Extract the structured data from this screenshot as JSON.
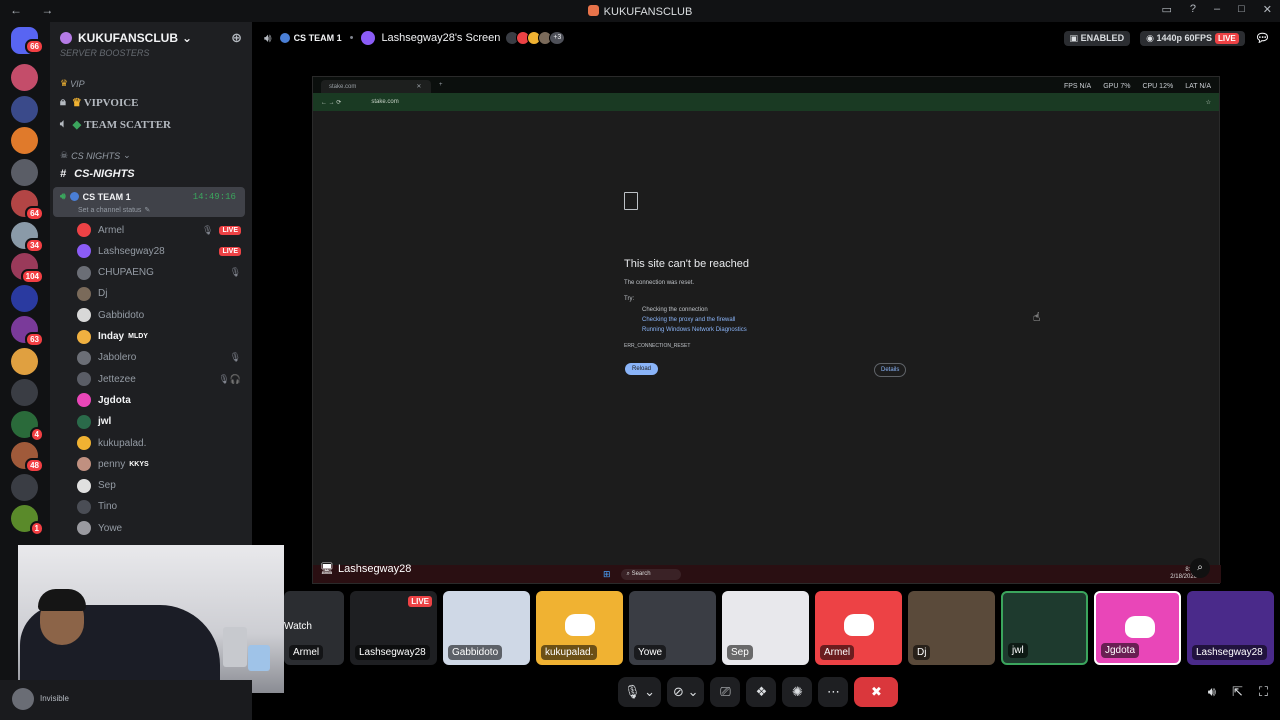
{
  "window": {
    "title": "KUKUFANSCLUB",
    "nav_label": "← →",
    "controls": [
      "▭",
      "?",
      "–",
      "□",
      "✕"
    ]
  },
  "rail": {
    "dm_badge": "66",
    "servers": [
      {
        "color": "#c44d6a",
        "badge": ""
      },
      {
        "color": "#3a4a8a",
        "badge": ""
      },
      {
        "color": "#e07a2b",
        "badge": ""
      },
      {
        "color": "#5a5d66",
        "badge": ""
      },
      {
        "color": "#b34545",
        "badge": "64"
      },
      {
        "color": "#8a9aa8",
        "badge": "34"
      },
      {
        "color": "#9a3a5a",
        "badge": "104"
      },
      {
        "color": "#2a3aa0",
        "badge": ""
      },
      {
        "color": "#7a3a9a",
        "badge": "63"
      },
      {
        "color": "#e0a040",
        "badge": ""
      },
      {
        "color": "#3a3d44",
        "badge": ""
      },
      {
        "color": "#2a6a3a",
        "badge": "4"
      },
      {
        "color": "#a05a3a",
        "badge": "48"
      },
      {
        "color": "#3a3d44",
        "badge": ""
      },
      {
        "color": "#5a8a2a",
        "badge": "1"
      }
    ]
  },
  "sidebar": {
    "server_name": "KUKUFANSCLUB",
    "partial_top": "SERVER BOOSTERS",
    "vip_category": "VIP",
    "vip_channels": [
      "VIPVOICE",
      "TEAM SCATTER"
    ],
    "cs_category": "CS NIGHTS",
    "text_channel": "CS-NIGHTS",
    "active_channel": {
      "name": "CS TEAM 1",
      "timer": "14:49:16",
      "status_hint": "Set a channel status"
    },
    "users": [
      {
        "name": "Armel",
        "live": "LIVE",
        "muted": "🎙",
        "bold": false,
        "color": "#ed4245"
      },
      {
        "name": "Lashsegway28",
        "live": "LIVE",
        "muted": "",
        "bold": false,
        "color": "#8b5cf6"
      },
      {
        "name": "CHUPAENG",
        "live": "",
        "muted": "🎙",
        "bold": false,
        "color": "#6b6e76"
      },
      {
        "name": "Dj",
        "live": "",
        "muted": "",
        "bold": false,
        "color": "#7a6a5a"
      },
      {
        "name": "Gabbidoto",
        "live": "",
        "muted": "",
        "bold": false,
        "color": "#d8d8d8"
      },
      {
        "name": "Inday",
        "live": "",
        "muted": "",
        "bold": true,
        "tag": "MLDY",
        "color": "#f0b040"
      },
      {
        "name": "Jabolero",
        "live": "",
        "muted": "🎙",
        "bold": false,
        "color": "#6b6e76"
      },
      {
        "name": "Jettezee",
        "live": "",
        "muted": "🎙🎧",
        "bold": false,
        "color": "#5a5d66"
      },
      {
        "name": "Jgdota",
        "live": "",
        "muted": "",
        "bold": true,
        "color": "#e946b8"
      },
      {
        "name": "jwl",
        "live": "",
        "muted": "",
        "bold": true,
        "color": "#2a6a4a"
      },
      {
        "name": "kukupalad.",
        "live": "",
        "muted": "",
        "bold": false,
        "color": "#f0b232"
      },
      {
        "name": "penny",
        "live": "",
        "muted": "",
        "bold": false,
        "tag": "KKYS",
        "color": "#c09080"
      },
      {
        "name": "Sep",
        "live": "",
        "muted": "",
        "bold": false,
        "color": "#e0e0e0"
      },
      {
        "name": "Tino",
        "live": "",
        "muted": "",
        "bold": false,
        "color": "#4a4d55"
      },
      {
        "name": "Yowe",
        "live": "",
        "muted": "",
        "bold": false,
        "color": "#9a9aa0"
      }
    ]
  },
  "header": {
    "channel": "CS TEAM 1",
    "screen_title": "Lashsegway28's Screen",
    "extra_count": "+3",
    "enabled_label": "ENABLED",
    "quality": "1440p 60FPS",
    "live": "LIVE"
  },
  "stream": {
    "tab_title": "stake.com",
    "url": "stake.com",
    "perf": [
      "FPS N/A",
      "GPU 7%",
      "CPU 12%",
      "LAT N/A"
    ],
    "error_title": "This site can't be reached",
    "error_sub": "The connection was reset.",
    "try": "Try:",
    "check1": "Checking the connection",
    "check2": "Checking the proxy and the firewall",
    "check3": "Running Windows Network Diagnostics",
    "code": "ERR_CONNECTION_RESET",
    "reload": "Reload",
    "details": "Details",
    "taskbar_search": "Search",
    "time": "8:44",
    "date": "2/18/2026",
    "streamer": "Lashsegway28"
  },
  "tiles": [
    {
      "name": "Armel",
      "color": "#2b2d31",
      "logo": false,
      "live": "",
      "partial": true,
      "overlay": "Watch"
    },
    {
      "name": "Lashsegway28",
      "color": "#1e1f22",
      "logo": false,
      "live": "LIVE"
    },
    {
      "name": "Gabbidoto",
      "color": "#cfd8e6",
      "logo": false,
      "live": ""
    },
    {
      "name": "kukupalad.",
      "color": "#f0b232",
      "logo": true,
      "live": ""
    },
    {
      "name": "Yowe",
      "color": "#3a3d44",
      "logo": false,
      "live": ""
    },
    {
      "name": "Sep",
      "color": "#e8e8ec",
      "logo": false,
      "live": ""
    },
    {
      "name": "Armel",
      "color": "#ed4245",
      "logo": true,
      "live": ""
    },
    {
      "name": "Dj",
      "color": "#5a4a3a",
      "logo": false,
      "live": ""
    },
    {
      "name": "jwl",
      "color": "#1e3a2e",
      "logo": false,
      "live": ""
    },
    {
      "name": "Jgdota",
      "color": "#e946b8",
      "logo": true,
      "live": ""
    },
    {
      "name": "Lashsegway28",
      "color": "#4a2a8a",
      "logo": false,
      "live": ""
    }
  ],
  "user_panel": {
    "status": "Invisible"
  }
}
